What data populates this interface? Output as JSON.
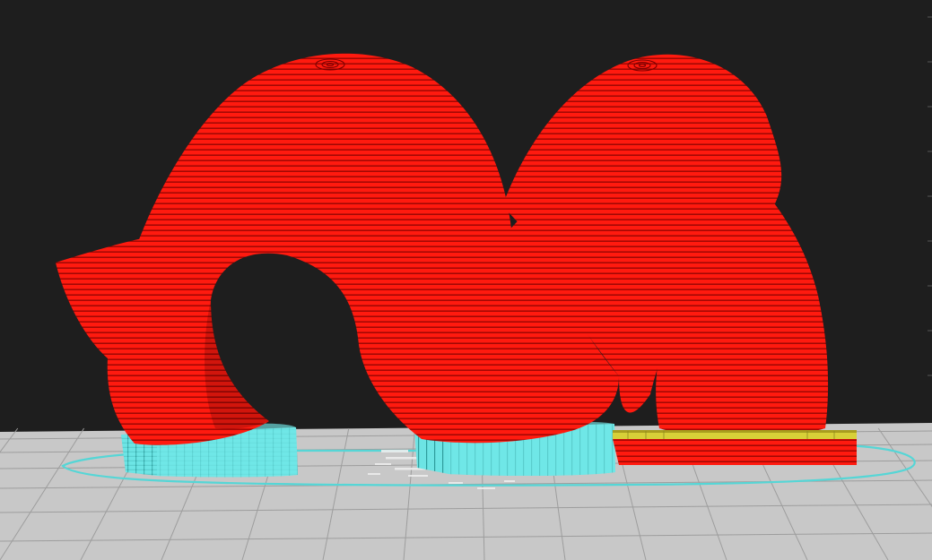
{
  "viewport": {
    "view": "layer-preview",
    "background_color": "#1e1e1e",
    "build_plate_color": "#c9c9c9",
    "build_plate_grid_color": "#9d9d9d"
  },
  "colors": {
    "outer_wall": "#ff1a0f",
    "outer_wall_shade": "#8a0000",
    "support": "#66e3e3",
    "support_shade": "#2b9d9d",
    "skirt": "#5fdcdc",
    "top_skin": "#d9d23a",
    "travel_marks": "#f2f2f2"
  },
  "model": {
    "name": "",
    "shape": "double-arch tube"
  },
  "icons": {
    "edge_markers": "scroll-tick-icon"
  }
}
